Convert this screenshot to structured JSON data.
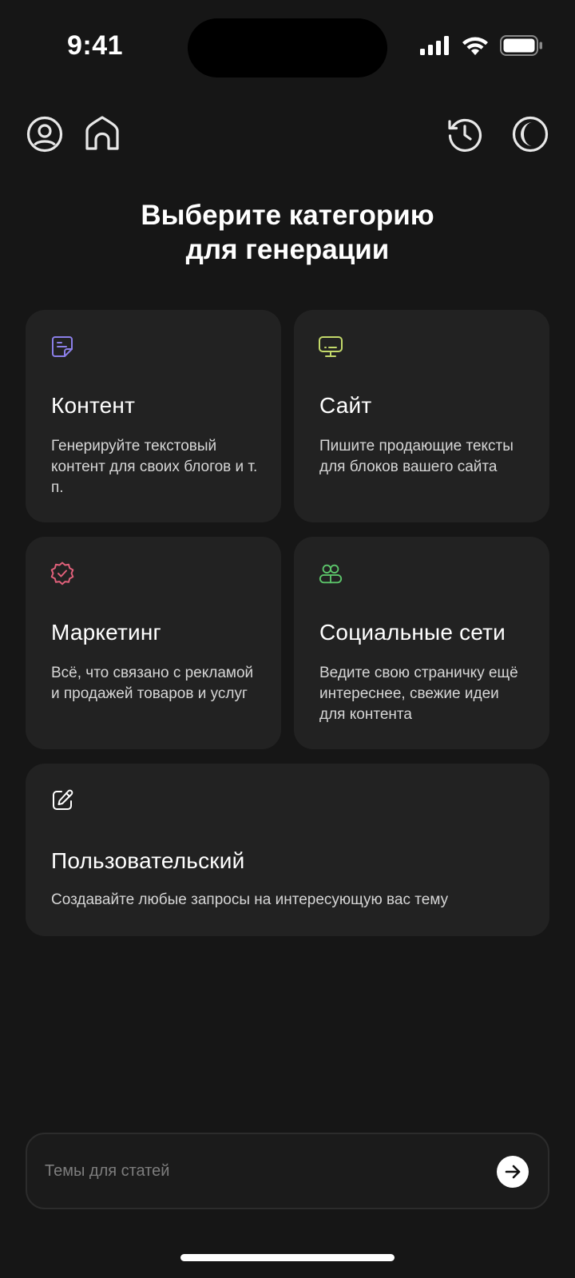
{
  "status_bar": {
    "time": "9:41"
  },
  "nav": {
    "profile_icon": "user-circle-icon",
    "home_icon": "home-icon",
    "history_icon": "history-icon",
    "theme_icon": "moon-icon"
  },
  "title": {
    "line1": "Выберите категорию",
    "line2": "для генерации"
  },
  "categories": [
    {
      "title": "Контент",
      "description": "Генерируйте текстовый контент для своих блогов и т. п.",
      "icon": "document-icon",
      "color": "#8b7fe8"
    },
    {
      "title": "Сайт",
      "description": "Пишите продающие тексты для блоков вашего сайта",
      "icon": "monitor-icon",
      "color": "#c3d96a"
    },
    {
      "title": "Маркетинг",
      "description": "Всё, что связано с рекламой и продажей товаров и услуг",
      "icon": "badge-check-icon",
      "color": "#e0607a"
    },
    {
      "title": "Социальные сети",
      "description": "Ведите свою страничку ещё интереснее, свежие идеи для контента",
      "icon": "users-icon",
      "color": "#5cc46a"
    },
    {
      "title": "Пользовательский",
      "description": "Создавайте любые запросы на интересующую вас тему",
      "icon": "edit-icon",
      "color": "#ffffff"
    }
  ],
  "input": {
    "placeholder": "Темы для статей",
    "value": ""
  },
  "colors": {
    "background": "#161616",
    "card": "#222222",
    "accent": "#ffffff"
  }
}
